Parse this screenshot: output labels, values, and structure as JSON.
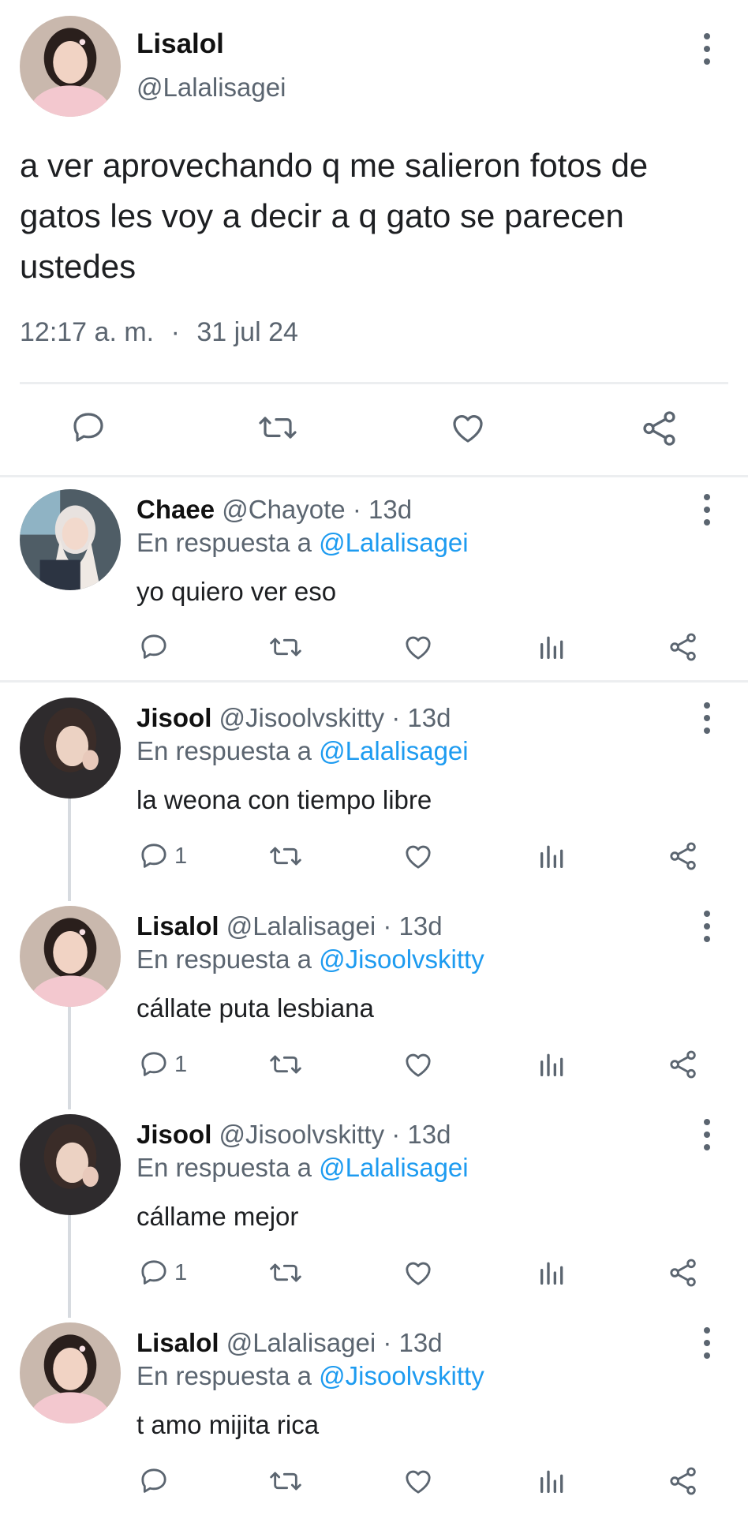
{
  "main_tweet": {
    "name": "Lisalol",
    "handle": "@Lalalisagei",
    "text": "a ver aprovechando q me salieron fotos de gatos les voy a decir a q gato se parecen ustedes",
    "time": "12:17 a. m.",
    "separator": "·",
    "date": "31 jul 24"
  },
  "reply_prefix": "En respuesta a",
  "replies": [
    {
      "name": "Chaee",
      "handle": "@Chayote",
      "dot": "·",
      "age": "13d",
      "reply_to": "@Lalalisagei",
      "text": "yo quiero ver eso",
      "reply_count": ""
    },
    {
      "name": "Jisool",
      "handle": "@Jisoolvskitty",
      "dot": "·",
      "age": "13d",
      "reply_to": "@Lalalisagei",
      "text": "la weona con tiempo libre",
      "reply_count": "1"
    },
    {
      "name": "Lisalol",
      "handle": "@Lalalisagei",
      "dot": "·",
      "age": "13d",
      "reply_to": "@Jisoolvskitty",
      "text": "cállate puta lesbiana",
      "reply_count": "1"
    },
    {
      "name": "Jisool",
      "handle": "@Jisoolvskitty",
      "dot": "·",
      "age": "13d",
      "reply_to": "@Lalalisagei",
      "text": "cállame mejor",
      "reply_count": "1"
    },
    {
      "name": "Lisalol",
      "handle": "@Lalalisagei",
      "dot": "·",
      "age": "13d",
      "reply_to": "@Jisoolvskitty",
      "text": "t amo mijita rica",
      "reply_count": ""
    }
  ],
  "colors": {
    "link": "#1d9bf0",
    "muted": "#5b6570",
    "divider": "#eceef0",
    "thread_line": "#d7dbe0"
  },
  "icons": [
    "reply-icon",
    "retweet-icon",
    "like-icon",
    "views-icon",
    "share-icon",
    "more-icon"
  ]
}
